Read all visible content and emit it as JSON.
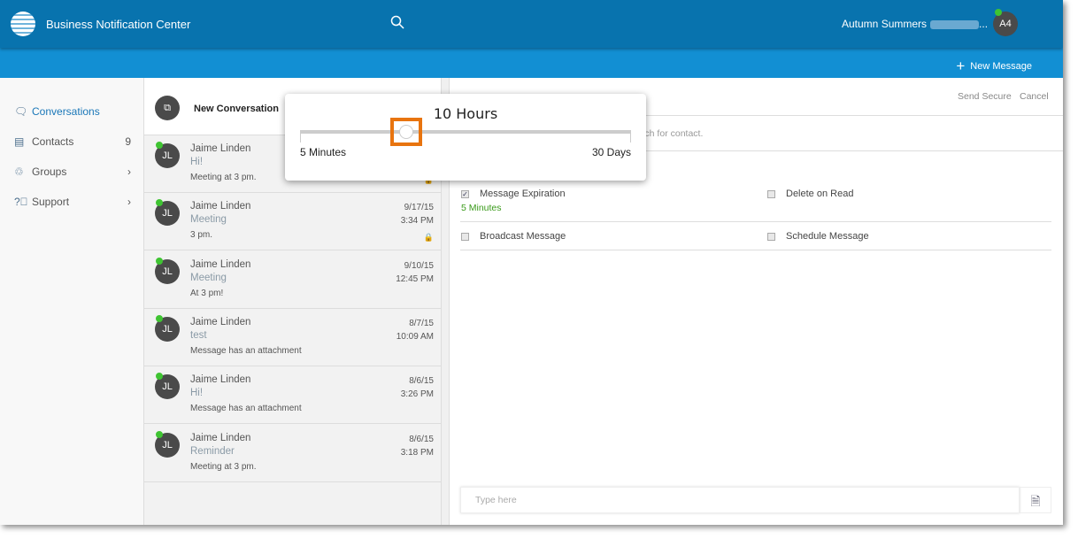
{
  "header": {
    "title": "Business Notification Center",
    "search_icon": "search-icon",
    "user_name": "Autumn Summers",
    "user_suffix": "...",
    "avatar": "A4"
  },
  "toolbar": {
    "new_message": "New Message"
  },
  "sidebar": {
    "items": [
      {
        "label": "Conversations",
        "icon": "chat-icon",
        "active": true
      },
      {
        "label": "Contacts",
        "icon": "contacts-icon",
        "count": "9"
      },
      {
        "label": "Groups",
        "icon": "groups-icon",
        "chevron": "›"
      },
      {
        "label": "Support",
        "icon": "help-icon",
        "chevron": "›"
      }
    ]
  },
  "list": {
    "new_conversation": "New Conversation",
    "items": [
      {
        "initials": "JL",
        "name": "Jaime Linden",
        "subject": "Hi!",
        "preview": "Meeting at 3 pm.",
        "date": "",
        "time": ""
      },
      {
        "initials": "JL",
        "name": "Jaime Linden",
        "subject": "Meeting",
        "preview": "3 pm.",
        "date": "9/17/15",
        "time": "3:34 PM"
      },
      {
        "initials": "JL",
        "name": "Jaime Linden",
        "subject": "Meeting",
        "preview": "At 3 pm!",
        "date": "9/10/15",
        "time": "12:45 PM"
      },
      {
        "initials": "JL",
        "name": "Jaime Linden",
        "subject": "test",
        "preview": "Message has an attachment",
        "date": "8/7/15",
        "time": "10:09 AM"
      },
      {
        "initials": "JL",
        "name": "Jaime Linden",
        "subject": "Hi!",
        "preview": "Message has an attachment",
        "date": "8/6/15",
        "time": "3:26 PM"
      },
      {
        "initials": "JL",
        "name": "Jaime Linden",
        "subject": "Reminder",
        "preview": "Meeting at 3 pm.",
        "date": "8/6/15",
        "time": "3:18 PM"
      }
    ]
  },
  "compose": {
    "send_secure": "Send Secure",
    "cancel": "Cancel",
    "to_placeholder": "search for contact.",
    "message_expiration": "Message Expiration",
    "expiration_value": "5 Minutes",
    "delete_on_read": "Delete on Read",
    "broadcast": "Broadcast Message",
    "schedule": "Schedule Message",
    "message_placeholder": "Type here",
    "expiration_checked": true
  },
  "popup": {
    "value": "10 Hours",
    "min_label": "5 Minutes",
    "max_label": "30 Days",
    "slider_fraction": 0.32
  },
  "colors": {
    "header": "#0873ae",
    "toolbar": "#128fd3",
    "highlight": "#e8740f",
    "online": "#3fc432",
    "expiration": "#3a9a1a"
  }
}
